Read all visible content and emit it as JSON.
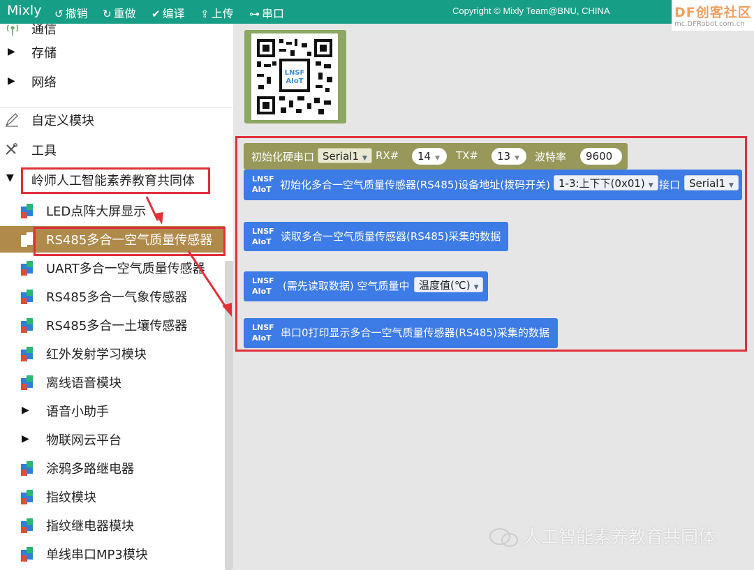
{
  "app": {
    "title": "Mixly",
    "copyright": "Copyright © Mixly Team@BNU, CHINA"
  },
  "toolbar": [
    {
      "icon": "undo-icon",
      "label": "撤销"
    },
    {
      "icon": "redo-icon",
      "label": "重做"
    },
    {
      "icon": "compile-icon",
      "label": "编译"
    },
    {
      "icon": "upload-icon",
      "label": "上传"
    },
    {
      "icon": "usb-icon",
      "label": "串口"
    }
  ],
  "watermark": {
    "logo_big": "DF创客社区",
    "logo_small": "mc.DFRobot.com.cn",
    "wechat": "人工智能素养教育共同体"
  },
  "sidebar": {
    "items": [
      {
        "label": "通信",
        "kind": "category-icon"
      },
      {
        "label": "存储",
        "kind": "collapsed"
      },
      {
        "label": "网络",
        "kind": "collapsed"
      },
      {
        "label": "自定义模块",
        "kind": "pen-icon"
      },
      {
        "label": "工具",
        "kind": "tools-icon"
      },
      {
        "label": "岭师人工智能素养教育共同体",
        "kind": "expanded"
      },
      {
        "label": "LED点阵大屏显示",
        "kind": "blocks"
      },
      {
        "label": "RS485多合一空气质量传感器",
        "kind": "blocks",
        "selected": true
      },
      {
        "label": "UART多合一空气质量传感器",
        "kind": "blocks"
      },
      {
        "label": "RS485多合一气象传感器",
        "kind": "blocks"
      },
      {
        "label": "RS485多合一土壤传感器",
        "kind": "blocks"
      },
      {
        "label": "红外发射学习模块",
        "kind": "blocks"
      },
      {
        "label": "离线语音模块",
        "kind": "blocks"
      },
      {
        "label": "语音小助手",
        "kind": "collapsed"
      },
      {
        "label": "物联网云平台",
        "kind": "collapsed"
      },
      {
        "label": "涂鸦多路继电器",
        "kind": "blocks"
      },
      {
        "label": "指纹模块",
        "kind": "blocks"
      },
      {
        "label": "指纹继电器模块",
        "kind": "blocks"
      },
      {
        "label": "单线串口MP3模块",
        "kind": "blocks"
      }
    ]
  },
  "qr": {
    "logo_line1": "LNSF",
    "logo_line2": "AIoT"
  },
  "blocks": {
    "logo_line1": "LNSF",
    "logo_line2": "AIoT",
    "init_serial": {
      "label": "初始化硬串口",
      "port": "Serial1",
      "rx_label": "RX#",
      "rx": "14",
      "tx_label": "TX#",
      "tx": "13",
      "baud_label": "波特率",
      "baud": "9600"
    },
    "init_sensor": {
      "label": "初始化多合一空气质量传感器(RS485)设备地址(拨码开关)",
      "address": "1-3:上下下(0x01)",
      "port_label": "接口",
      "port": "Serial1"
    },
    "read_sensor": {
      "label": "读取多合一空气质量传感器(RS485)采集的数据"
    },
    "get_value": {
      "label": "(需先读取数据) 空气质量中",
      "option": "温度值(℃)"
    },
    "print_sensor": {
      "label": "串口0打印显示多合一空气质量传感器(RS485)采集的数据"
    }
  }
}
